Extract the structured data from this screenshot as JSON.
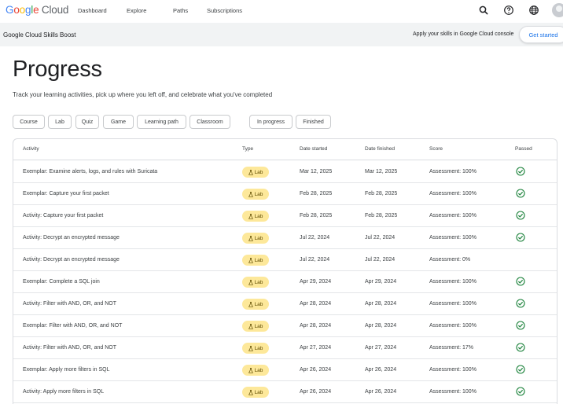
{
  "topnav": {
    "logo": {
      "g": "G",
      "o1": "o",
      "o2": "o",
      "g2": "g",
      "l": "l",
      "e": "e",
      "cloud": " Cloud"
    },
    "links": [
      "Dashboard",
      "Explore",
      "Paths",
      "Subscriptions"
    ],
    "icons": [
      "search-icon",
      "help-icon",
      "globe-icon",
      "avatar"
    ]
  },
  "subbar": {
    "brand": "Google Cloud Skills Boost",
    "promo": "Apply your skills in Google Cloud console",
    "cta": "Get started"
  },
  "page": {
    "title": "Progress",
    "subtitle": "Track your learning activities, pick up where you left off, and celebrate what you've completed"
  },
  "filters": {
    "type_chips": [
      "Course",
      "Lab",
      "Quiz",
      "Game",
      "Learning path",
      "Classroom"
    ],
    "status_chips": [
      "In progress",
      "Finished"
    ]
  },
  "table": {
    "headers": {
      "activity": "Activity",
      "type": "Type",
      "started": "Date started",
      "finished": "Date finished",
      "score": "Score",
      "passed": "Passed"
    },
    "rows": [
      {
        "activity": "Exemplar: Examine alerts, logs, and rules with Suricata",
        "type": "Lab",
        "started": "Mar 12, 2025",
        "finished": "Mar 12, 2025",
        "score": "Assessment: 100%",
        "passed": true
      },
      {
        "activity": "Exemplar: Capture your first packet",
        "type": "Lab",
        "started": "Feb 28, 2025",
        "finished": "Feb 28, 2025",
        "score": "Assessment: 100%",
        "passed": true
      },
      {
        "activity": "Activity: Capture your first packet",
        "type": "Lab",
        "started": "Feb 28, 2025",
        "finished": "Feb 28, 2025",
        "score": "Assessment: 100%",
        "passed": true
      },
      {
        "activity": "Activity: Decrypt an encrypted message",
        "type": "Lab",
        "started": "Jul 22, 2024",
        "finished": "Jul 22, 2024",
        "score": "Assessment: 100%",
        "passed": true
      },
      {
        "activity": "Activity: Decrypt an encrypted message",
        "type": "Lab",
        "started": "Jul 22, 2024",
        "finished": "Jul 22, 2024",
        "score": "Assessment: 0%",
        "passed": false
      },
      {
        "activity": "Exemplar: Complete a SQL join",
        "type": "Lab",
        "started": "Apr 29, 2024",
        "finished": "Apr 29, 2024",
        "score": "Assessment: 100%",
        "passed": true
      },
      {
        "activity": "Activity: Filter with AND, OR, and NOT",
        "type": "Lab",
        "started": "Apr 28, 2024",
        "finished": "Apr 28, 2024",
        "score": "Assessment: 100%",
        "passed": true
      },
      {
        "activity": "Exemplar: Filter with AND, OR, and NOT",
        "type": "Lab",
        "started": "Apr 28, 2024",
        "finished": "Apr 28, 2024",
        "score": "Assessment: 100%",
        "passed": true
      },
      {
        "activity": "Activity: Filter with AND, OR, and NOT",
        "type": "Lab",
        "started": "Apr 27, 2024",
        "finished": "Apr 27, 2024",
        "score": "Assessment: 17%",
        "passed": true
      },
      {
        "activity": "Exemplar: Apply more filters in SQL",
        "type": "Lab",
        "started": "Apr 26, 2024",
        "finished": "Apr 26, 2024",
        "score": "Assessment: 100%",
        "passed": true
      },
      {
        "activity": "Activity: Apply more filters in SQL",
        "type": "Lab",
        "started": "Apr 26, 2024",
        "finished": "Apr 26, 2024",
        "score": "Assessment: 100%",
        "passed": true
      }
    ]
  },
  "colors": {
    "accent": "#1a73e8",
    "lab_badge": "#fde89a",
    "passed": "#188038"
  }
}
